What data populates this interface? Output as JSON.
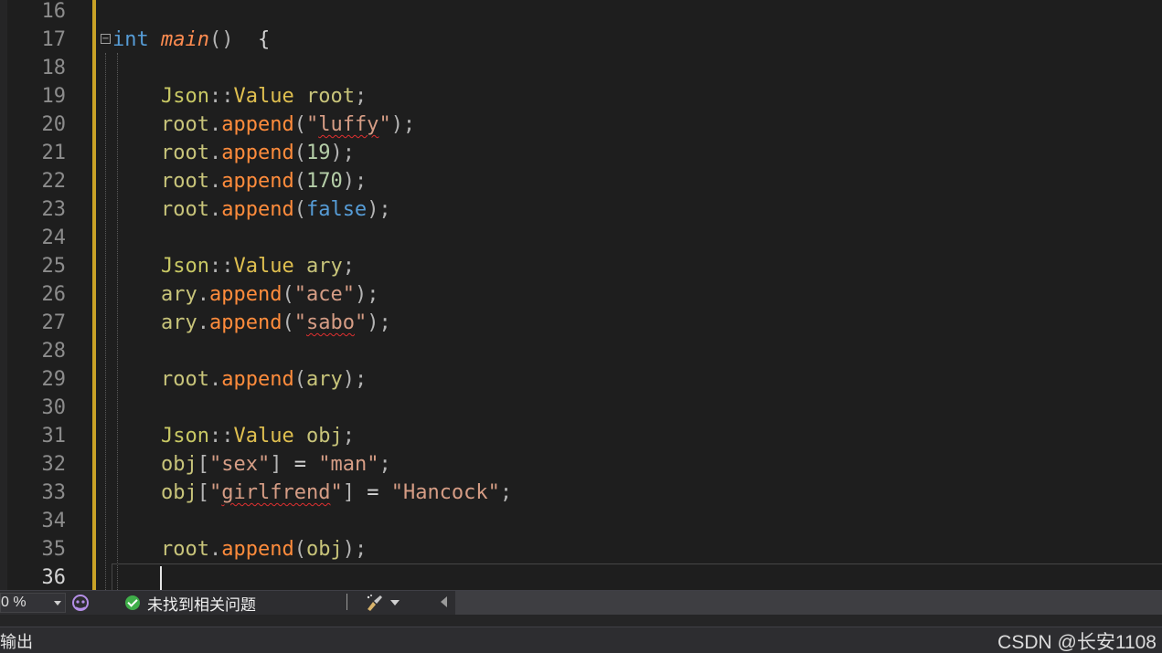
{
  "editor": {
    "lines": [
      {
        "n": "16",
        "tokens": []
      },
      {
        "n": "17",
        "tokens": [
          [
            "kw",
            "int"
          ],
          [
            "p",
            " "
          ],
          [
            "fn-it",
            "main"
          ],
          [
            "punc",
            "()"
          ],
          [
            "p",
            "  {"
          ]
        ]
      },
      {
        "n": "18",
        "tokens": []
      },
      {
        "n": "19",
        "tokens": [
          [
            "p",
            "    "
          ],
          [
            "ns",
            "Json"
          ],
          [
            "punc",
            "::"
          ],
          [
            "cls",
            "Value"
          ],
          [
            "p",
            " "
          ],
          [
            "var",
            "root"
          ],
          [
            "punc",
            ";"
          ]
        ]
      },
      {
        "n": "20",
        "tokens": [
          [
            "p",
            "    "
          ],
          [
            "var",
            "root"
          ],
          [
            "punc",
            "."
          ],
          [
            "mth",
            "append"
          ],
          [
            "punc",
            "("
          ],
          [
            "str",
            "\""
          ],
          [
            "str-sq",
            "luffy"
          ],
          [
            "str",
            "\""
          ],
          [
            "punc",
            ");"
          ]
        ]
      },
      {
        "n": "21",
        "tokens": [
          [
            "p",
            "    "
          ],
          [
            "var",
            "root"
          ],
          [
            "punc",
            "."
          ],
          [
            "mth",
            "append"
          ],
          [
            "punc",
            "("
          ],
          [
            "num",
            "19"
          ],
          [
            "punc",
            ");"
          ]
        ]
      },
      {
        "n": "22",
        "tokens": [
          [
            "p",
            "    "
          ],
          [
            "var",
            "root"
          ],
          [
            "punc",
            "."
          ],
          [
            "mth",
            "append"
          ],
          [
            "punc",
            "("
          ],
          [
            "num",
            "170"
          ],
          [
            "punc",
            ");"
          ]
        ]
      },
      {
        "n": "23",
        "tokens": [
          [
            "p",
            "    "
          ],
          [
            "var",
            "root"
          ],
          [
            "punc",
            "."
          ],
          [
            "mth",
            "append"
          ],
          [
            "punc",
            "("
          ],
          [
            "boolv",
            "false"
          ],
          [
            "punc",
            ");"
          ]
        ]
      },
      {
        "n": "24",
        "tokens": []
      },
      {
        "n": "25",
        "tokens": [
          [
            "p",
            "    "
          ],
          [
            "ns",
            "Json"
          ],
          [
            "punc",
            "::"
          ],
          [
            "cls",
            "Value"
          ],
          [
            "p",
            " "
          ],
          [
            "var",
            "ary"
          ],
          [
            "punc",
            ";"
          ]
        ]
      },
      {
        "n": "26",
        "tokens": [
          [
            "p",
            "    "
          ],
          [
            "var",
            "ary"
          ],
          [
            "punc",
            "."
          ],
          [
            "mth",
            "append"
          ],
          [
            "punc",
            "("
          ],
          [
            "str",
            "\"ace\""
          ],
          [
            "punc",
            ");"
          ]
        ]
      },
      {
        "n": "27",
        "tokens": [
          [
            "p",
            "    "
          ],
          [
            "var",
            "ary"
          ],
          [
            "punc",
            "."
          ],
          [
            "mth",
            "append"
          ],
          [
            "punc",
            "("
          ],
          [
            "str",
            "\""
          ],
          [
            "str-sq",
            "sabo"
          ],
          [
            "str",
            "\""
          ],
          [
            "punc",
            ");"
          ]
        ]
      },
      {
        "n": "28",
        "tokens": []
      },
      {
        "n": "29",
        "tokens": [
          [
            "p",
            "    "
          ],
          [
            "var",
            "root"
          ],
          [
            "punc",
            "."
          ],
          [
            "mth",
            "append"
          ],
          [
            "punc",
            "("
          ],
          [
            "var",
            "ary"
          ],
          [
            "punc",
            ");"
          ]
        ]
      },
      {
        "n": "30",
        "tokens": []
      },
      {
        "n": "31",
        "tokens": [
          [
            "p",
            "    "
          ],
          [
            "ns",
            "Json"
          ],
          [
            "punc",
            "::"
          ],
          [
            "cls",
            "Value"
          ],
          [
            "p",
            " "
          ],
          [
            "var",
            "obj"
          ],
          [
            "punc",
            ";"
          ]
        ]
      },
      {
        "n": "32",
        "tokens": [
          [
            "p",
            "    "
          ],
          [
            "var",
            "obj"
          ],
          [
            "punc",
            "["
          ],
          [
            "str",
            "\"sex\""
          ],
          [
            "punc",
            "]"
          ],
          [
            "p",
            " = "
          ],
          [
            "str",
            "\"man\""
          ],
          [
            "punc",
            ";"
          ]
        ]
      },
      {
        "n": "33",
        "tokens": [
          [
            "p",
            "    "
          ],
          [
            "var",
            "obj"
          ],
          [
            "punc",
            "["
          ],
          [
            "str",
            "\""
          ],
          [
            "str-sq",
            "girlfrend"
          ],
          [
            "str",
            "\""
          ],
          [
            "punc",
            "]"
          ],
          [
            "p",
            " = "
          ],
          [
            "str",
            "\"Hancock\""
          ],
          [
            "punc",
            ";"
          ]
        ]
      },
      {
        "n": "34",
        "tokens": []
      },
      {
        "n": "35",
        "tokens": [
          [
            "p",
            "    "
          ],
          [
            "var",
            "root"
          ],
          [
            "punc",
            "."
          ],
          [
            "mth",
            "append"
          ],
          [
            "punc",
            "("
          ],
          [
            "var",
            "obj"
          ],
          [
            "punc",
            ");"
          ]
        ]
      },
      {
        "n": "36",
        "tokens": []
      }
    ],
    "current_line": "36"
  },
  "statusbar": {
    "zoom": "0 %",
    "issues_text": "未找到相关问题"
  },
  "output": {
    "tab_label": "输出"
  },
  "watermark": "CSDN @长安1108"
}
